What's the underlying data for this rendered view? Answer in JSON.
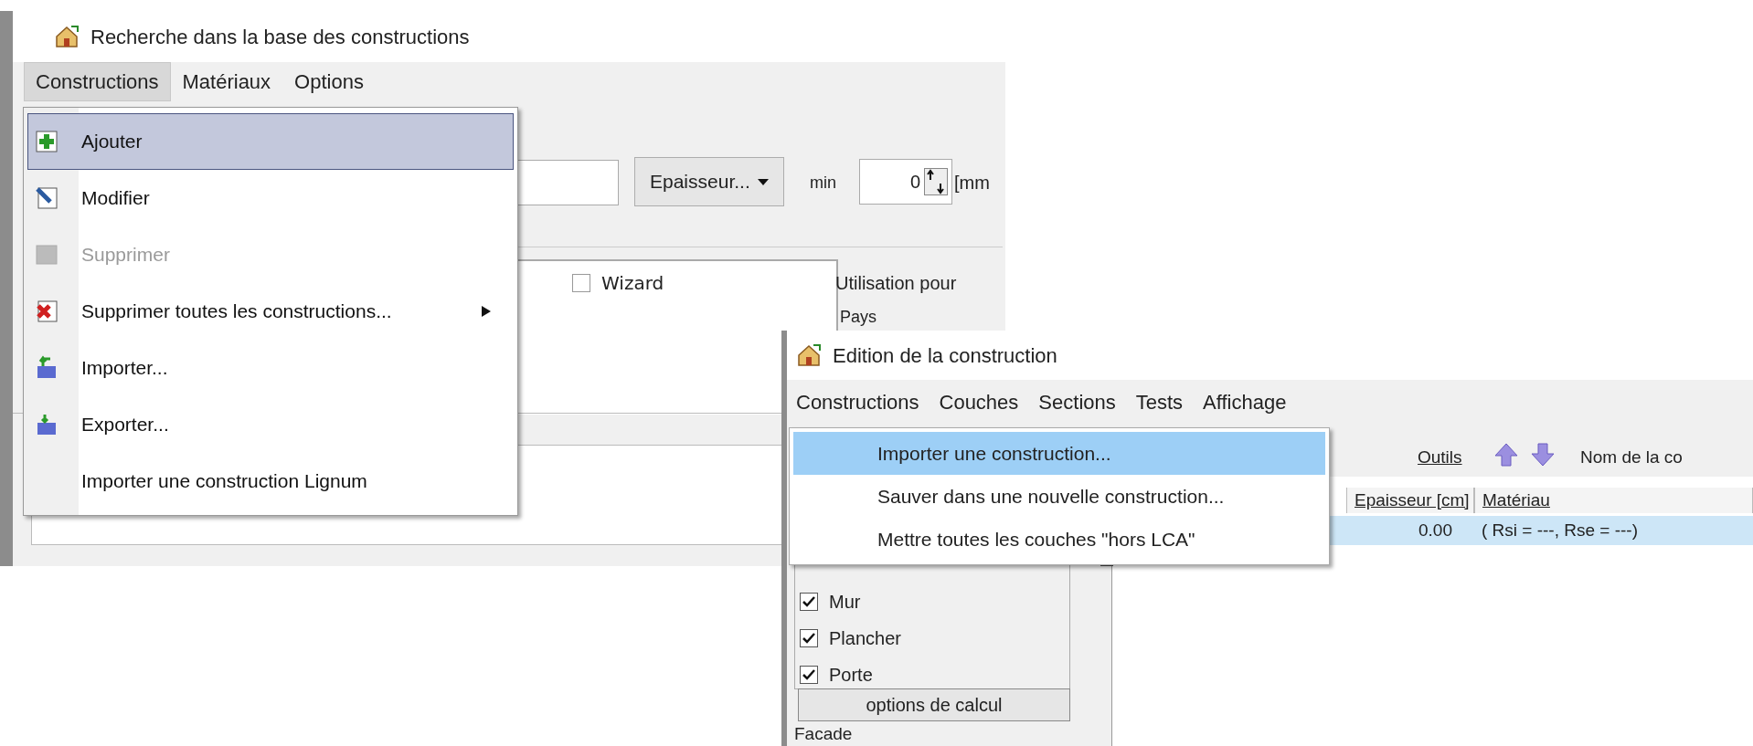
{
  "search_window": {
    "title": "Recherche dans la base des constructions",
    "menu": [
      {
        "label": "Constructions",
        "selected": true
      },
      {
        "label": "Matériaux",
        "selected": false
      },
      {
        "label": "Options",
        "selected": false
      }
    ],
    "menu_dropdown": [
      {
        "label": "Ajouter",
        "kind": "add",
        "selected": true,
        "disabled": false,
        "submenu": false
      },
      {
        "label": "Modifier",
        "kind": "edit",
        "selected": false,
        "disabled": false,
        "submenu": false
      },
      {
        "label": "Supprimer",
        "kind": "delete",
        "selected": false,
        "disabled": true,
        "submenu": false
      },
      {
        "label": "Supprimer toutes les constructions...",
        "kind": "delete-all",
        "selected": false,
        "disabled": false,
        "submenu": true
      },
      {
        "label": "Importer...",
        "kind": "import",
        "selected": false,
        "disabled": false,
        "submenu": false
      },
      {
        "label": "Exporter...",
        "kind": "export",
        "selected": false,
        "disabled": false,
        "submenu": false
      },
      {
        "label": "Importer une construction Lignum",
        "kind": "plain",
        "selected": false,
        "disabled": false,
        "submenu": false
      }
    ],
    "thickness_button": "Epaisseur...",
    "min_label": "min",
    "min_value": "0",
    "unit_label": "[mm",
    "wizard": {
      "label": "Wizard",
      "checked": false
    },
    "usage_label": "Utilisation pour",
    "country_label": "Pays"
  },
  "edit_window": {
    "title": "Edition de la construction",
    "menu": [
      "Constructions",
      "Couches",
      "Sections",
      "Tests",
      "Affichage"
    ],
    "menu_dropdown": [
      {
        "label": "Importer une construction...",
        "selected": true
      },
      {
        "label": "Sauver dans une nouvelle construction...",
        "selected": false
      },
      {
        "label": "Mettre toutes les couches \"hors LCA\"",
        "selected": false
      }
    ],
    "toolbar": {
      "tools": "Outils",
      "name_label": "Nom de la co"
    },
    "layers_table": {
      "columns": [
        "Epaisseur [cm]",
        "Matériau"
      ],
      "rows": [
        {
          "cells": [
            "0.00",
            "( Rsi = ---, Rse = ---)"
          ],
          "selected": true
        }
      ]
    },
    "filters": [
      {
        "label": "Mur",
        "checked": true
      },
      {
        "label": "Plancher",
        "checked": true
      },
      {
        "label": "Porte",
        "checked": true
      }
    ],
    "calc_options_button": "options de calcul",
    "facade_label": "Facade"
  }
}
